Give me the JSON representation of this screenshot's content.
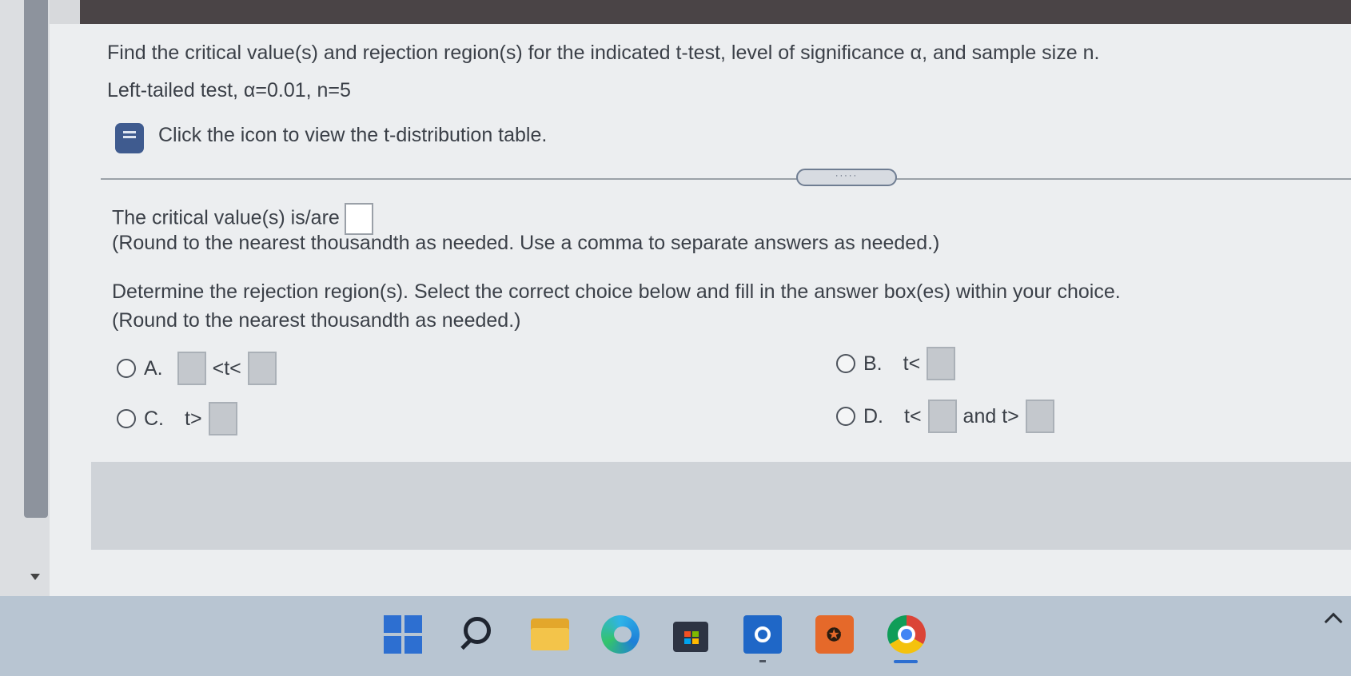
{
  "question": {
    "title": "Find the critical value(s) and rejection region(s) for the indicated t-test, level of significance α, and sample size n.",
    "params": "Left-tailed test, α=0.01, n=5"
  },
  "table_link": {
    "label": "Click the icon to view the t-distribution table."
  },
  "divider_handle": "·····",
  "critical_value": {
    "prompt": "The critical value(s) is/are",
    "note": "(Round to the nearest thousandth as needed. Use a comma to separate answers as needed.)",
    "value": ""
  },
  "rejection": {
    "prompt": "Determine the rejection region(s). Select the correct choice below and fill in the answer box(es) within your choice.",
    "note": "(Round to the nearest thousandth as needed.)"
  },
  "options": {
    "a": {
      "letter": "A.",
      "mid": "<t<"
    },
    "b": {
      "letter": "B.",
      "pre": "t<"
    },
    "c": {
      "letter": "C.",
      "pre": "t>"
    },
    "d": {
      "letter": "D.",
      "pre": "t<",
      "mid": "and t>"
    }
  },
  "taskbar": {
    "icons": [
      "windows-start-icon",
      "search-icon",
      "file-explorer-icon",
      "edge-browser-icon",
      "microsoft-store-icon",
      "outlook-icon",
      "game-app-icon",
      "chrome-browser-icon"
    ]
  }
}
